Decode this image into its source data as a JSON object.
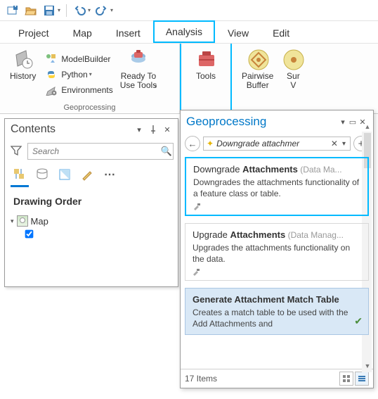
{
  "qat": {
    "items": [
      "new-project",
      "open-project",
      "save",
      "undo",
      "redo"
    ]
  },
  "tabs": {
    "items": [
      {
        "label": "Project"
      },
      {
        "label": "Map"
      },
      {
        "label": "Insert"
      },
      {
        "label": "Analysis",
        "active": true
      },
      {
        "label": "View"
      },
      {
        "label": "Edit"
      }
    ]
  },
  "ribbon": {
    "history_label": "History",
    "modelbuilder_label": "ModelBuilder",
    "python_label": "Python",
    "environments_label": "Environments",
    "ready_label_line1": "Ready To",
    "ready_label_line2": "Use Tools",
    "tools_label": "Tools",
    "pairwise_line1": "Pairwise",
    "pairwise_line2": "Buffer",
    "sum_line1": "Sur",
    "sum_line2": "V",
    "group1_label": "Geoprocessing"
  },
  "contents": {
    "title": "Contents",
    "search_placeholder": "Search",
    "section_title": "Drawing Order",
    "tree": {
      "root": "Map"
    }
  },
  "geo": {
    "title": "Geoprocessing",
    "search_text": "Downgrade attachmer",
    "results": [
      {
        "title_pre": "Downgrade ",
        "title_bold": "Attachments",
        "category": " (Data Ma...",
        "desc": "Downgrades the attachments functionality of a feature class or table."
      },
      {
        "title_pre": "Upgrade ",
        "title_bold": "Attachments",
        "category": " (Data Manag...",
        "desc": "Upgrades the attachments functionality on the data."
      },
      {
        "title_pre": "Generate ",
        "title_bold": "Attachment",
        "title_post": " Match Table",
        "category": "",
        "desc": "Creates a match table to be used with the Add Attachments and"
      }
    ],
    "footer_count": "17 Items"
  }
}
